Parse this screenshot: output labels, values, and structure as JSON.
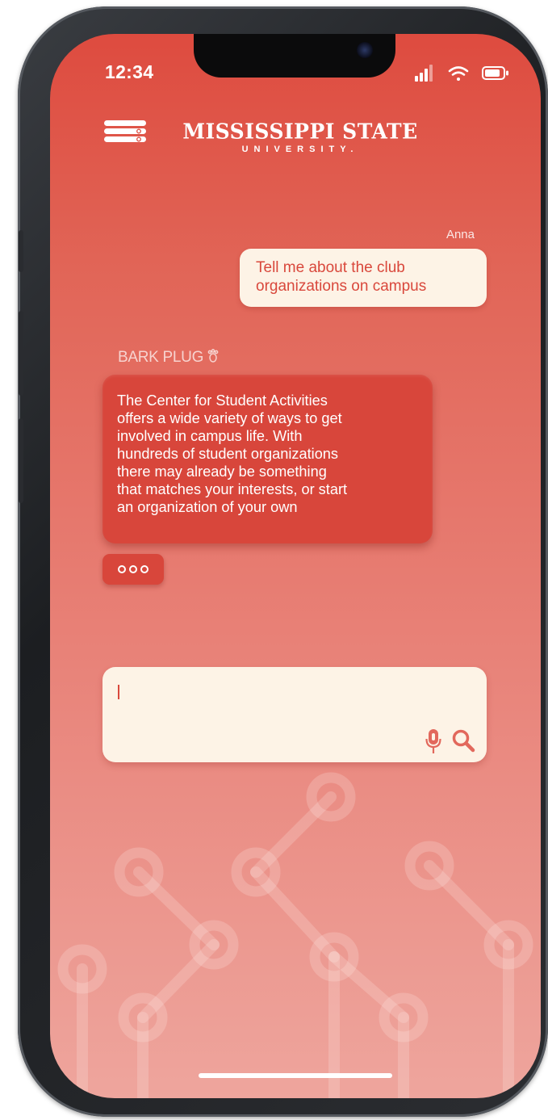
{
  "status_bar": {
    "time": "12:34",
    "icons": [
      "signal-icon",
      "wifi-icon",
      "battery-icon"
    ]
  },
  "header": {
    "menu_icon": "menu-icon",
    "brand_main": "MISSISSIPPI STATE",
    "brand_sub": "UNIVERSITY."
  },
  "chat": {
    "user": {
      "name": "Anna",
      "message_lines": [
        "Tell me about the club",
        "organizations on campus"
      ]
    },
    "bot": {
      "name": "BARK PLUG",
      "message_lines": [
        "The Center for Student Activities",
        "offers a wide variety of ways to get",
        "involved in campus life. With",
        "hundreds of student organizations",
        "there may already be something",
        "that matches your interests, or start",
        "an organization of your own"
      ]
    },
    "more_icon": "more-options-icon"
  },
  "input": {
    "value": "",
    "mic_icon": "microphone-icon",
    "search_icon": "search-icon"
  },
  "colors": {
    "accent": "#d8463b",
    "bubble_light": "#fdf3e6",
    "gradient_top": "#de4b3f",
    "gradient_bottom": "#eea59d"
  }
}
